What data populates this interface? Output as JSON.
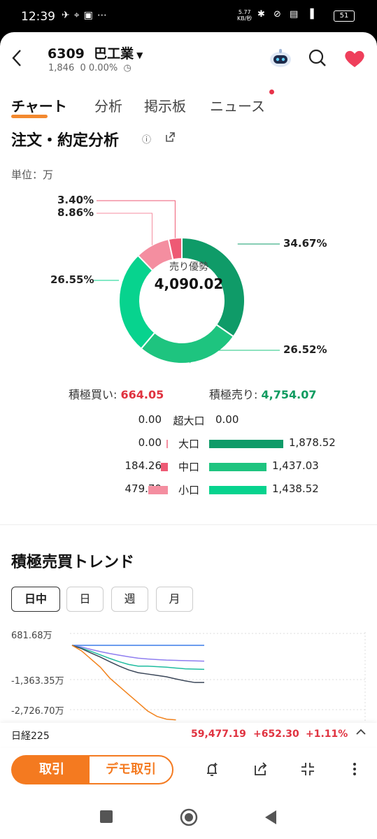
{
  "status_bar": {
    "time": "12:39",
    "speed_value": "5.77",
    "speed_unit": "KB/秒",
    "battery": "51"
  },
  "header": {
    "stock_code": "6309",
    "stock_name": "巴工業",
    "price": "1,846",
    "change": "0",
    "change_pct": "0.00%"
  },
  "tabs": [
    {
      "label": "チャート",
      "active": true
    },
    {
      "label": "分析",
      "active": false
    },
    {
      "label": "掲示板",
      "active": false
    },
    {
      "label": "ニュース",
      "active": false
    }
  ],
  "order_analysis": {
    "title": "注文・約定分析",
    "unit_label": "単位：万",
    "center_label": "売り優勢",
    "center_value": "4,090.02",
    "buy_label": "積極買い:",
    "buy_value": "664.05",
    "sell_label": "積極売り:",
    "sell_value": "4,754.07",
    "rows": [
      {
        "label": "超大口",
        "buy": "0.00",
        "sell": "0.00"
      },
      {
        "label": "大口",
        "buy": "0.00",
        "sell": "1,878.52"
      },
      {
        "label": "中口",
        "buy": "184.26",
        "sell": "1,437.03"
      },
      {
        "label": "小口",
        "buy": "479.79",
        "sell": "1,438.52"
      }
    ]
  },
  "chart_data": [
    {
      "type": "pie",
      "title": "",
      "categories": [
        "売り大口",
        "売り中口",
        "売り小口",
        "買い小口",
        "買い中口"
      ],
      "values": [
        34.67,
        26.52,
        26.55,
        8.86,
        3.4
      ],
      "labels": [
        "34.67%",
        "26.52%",
        "26.55%",
        "8.86%",
        "3.40%"
      ],
      "colors": [
        "#0f9b68",
        "#1ec47f",
        "#07d38e",
        "#f48ea0",
        "#ee5a74"
      ]
    },
    {
      "type": "line",
      "title": "積極売買トレンド",
      "y_tick_labels": [
        "681.68万",
        "-1,363.35万",
        "-2,726.70万"
      ],
      "ylim": [
        -2726.7,
        681.68
      ],
      "series": [
        {
          "color": "#3b7de8",
          "values": [
            0,
            0,
            0,
            0,
            0,
            0,
            0,
            0,
            0,
            0,
            0,
            0,
            0,
            0,
            0
          ]
        },
        {
          "color": "#8f7ef0",
          "values": [
            0,
            -60,
            -150,
            -230,
            -300,
            -360,
            -420,
            -470,
            -500,
            -520,
            -540,
            -550,
            -560,
            -570,
            -580
          ]
        },
        {
          "color": "#1fbca0",
          "values": [
            0,
            -100,
            -220,
            -350,
            -480,
            -600,
            -700,
            -760,
            -760,
            -780,
            -800,
            -830,
            -860,
            -870,
            -880
          ]
        },
        {
          "color": "#3a4658",
          "values": [
            0,
            -120,
            -280,
            -430,
            -600,
            -760,
            -900,
            -1000,
            -1050,
            -1100,
            -1150,
            -1230,
            -1300,
            -1360,
            -1360
          ]
        },
        {
          "color": "#f2831d",
          "values": [
            0,
            -200,
            -500,
            -800,
            -1200,
            -1500,
            -1800,
            -2100,
            -2400,
            -2600,
            -2700,
            -2726
          ]
        }
      ]
    }
  ],
  "trend": {
    "title": "積極売買トレンド",
    "periods": [
      "日中",
      "日",
      "週",
      "月"
    ],
    "selected_period": "日中"
  },
  "ticker": {
    "name": "日経225",
    "value": "59,477.19",
    "change": "+652.30",
    "change_pct": "+1.11%"
  },
  "bottom_bar": {
    "trade_label": "取引",
    "demo_label": "デモ取引"
  },
  "colors": {
    "accent": "#f47a20",
    "up_red": "#e03340",
    "down_green": "#0f9b60"
  }
}
